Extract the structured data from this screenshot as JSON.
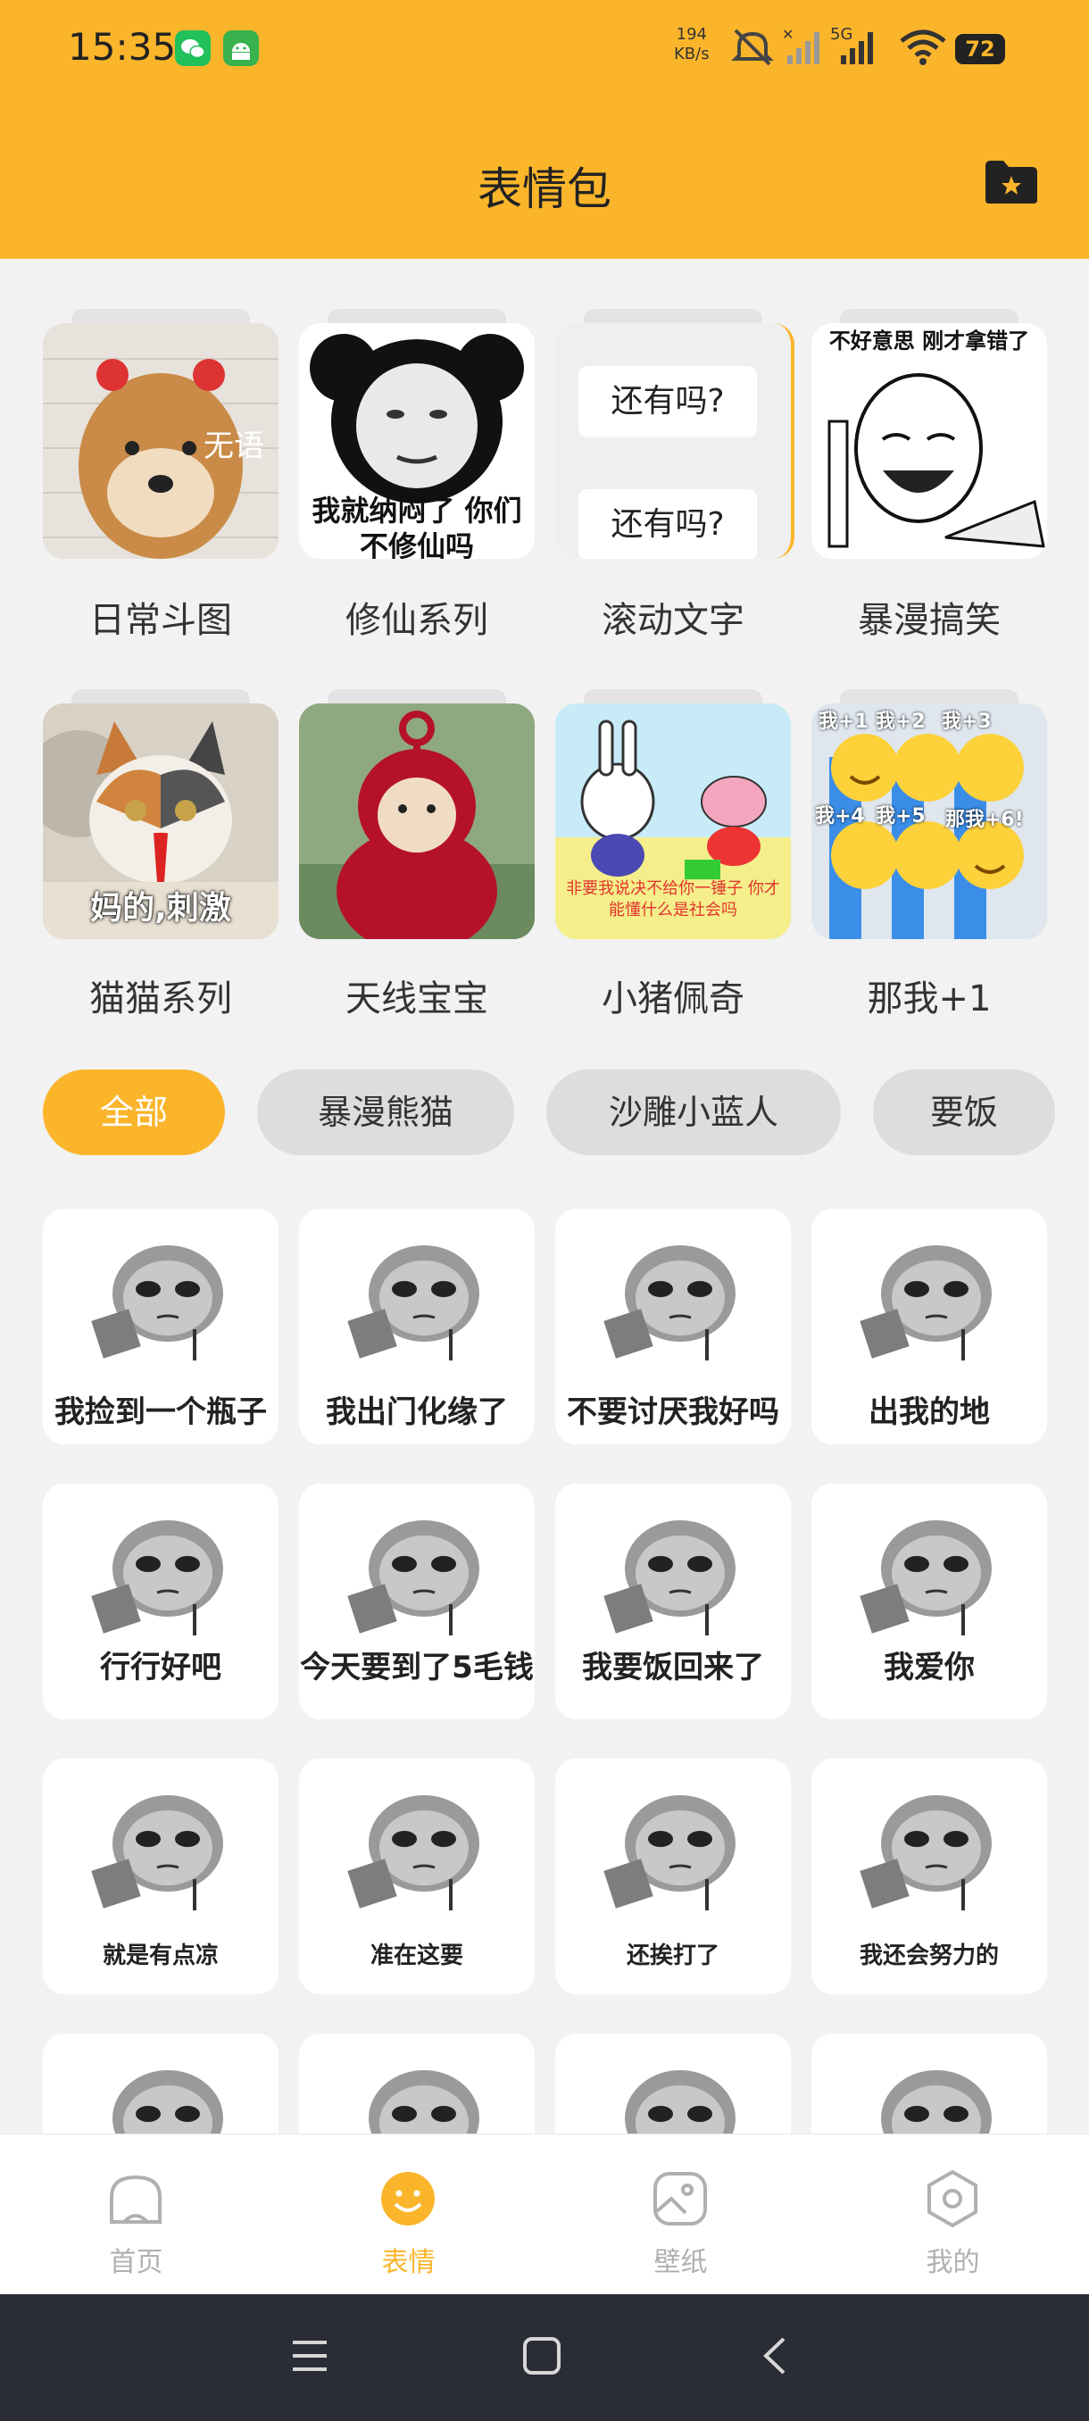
{
  "status_bar": {
    "time": "15:35",
    "net_speed_value": "194",
    "net_speed_unit": "KB/s",
    "network": "5G",
    "battery": "72"
  },
  "header": {
    "title": "表情包"
  },
  "categories": [
    {
      "label": "日常斗图",
      "overlay": "无语"
    },
    {
      "label": "修仙系列",
      "overlay": "我就纳闷了 你们不修仙吗"
    },
    {
      "label": "滚动文字",
      "bubble1": "还有吗?",
      "bubble2": "还有吗?"
    },
    {
      "label": "暴漫搞笑",
      "overlay": "不好意思 刚才拿错了"
    },
    {
      "label": "猫猫系列",
      "overlay": "妈的,刺激"
    },
    {
      "label": "天线宝宝"
    },
    {
      "label": "小猪佩奇",
      "overlay": "非要我说决不给你一锤子 你才能懂什么是社会吗"
    },
    {
      "label": "那我+1",
      "t1": "我+1",
      "t2": "我+2",
      "t3": "我+3",
      "t4": "我+4",
      "t5": "我+5",
      "t6": "那我+6!"
    }
  ],
  "filter_chips": [
    "全部",
    "暴漫熊猫",
    "沙雕小蓝人",
    "要饭"
  ],
  "grid": [
    "我捡到一个瓶子",
    "我出门化缘了",
    "不要讨厌我好吗",
    "出我的地",
    "行行好吧",
    "今天要到了5毛钱",
    "我要饭回来了",
    "我爱你",
    "就是有点凉",
    "准在这要",
    "还挨打了",
    "我还会努力的",
    "",
    "",
    "",
    ""
  ],
  "bottom_nav": [
    {
      "label": "首页",
      "icon": "home-icon"
    },
    {
      "label": "表情",
      "icon": "smile-icon"
    },
    {
      "label": "壁纸",
      "icon": "wallpaper-icon"
    },
    {
      "label": "我的",
      "icon": "profile-icon"
    }
  ],
  "colors": {
    "accent": "#fbb52b",
    "background": "#f2f2f2",
    "nav_inactive": "#b0b0b0",
    "system_bar": "#2b2d36"
  }
}
